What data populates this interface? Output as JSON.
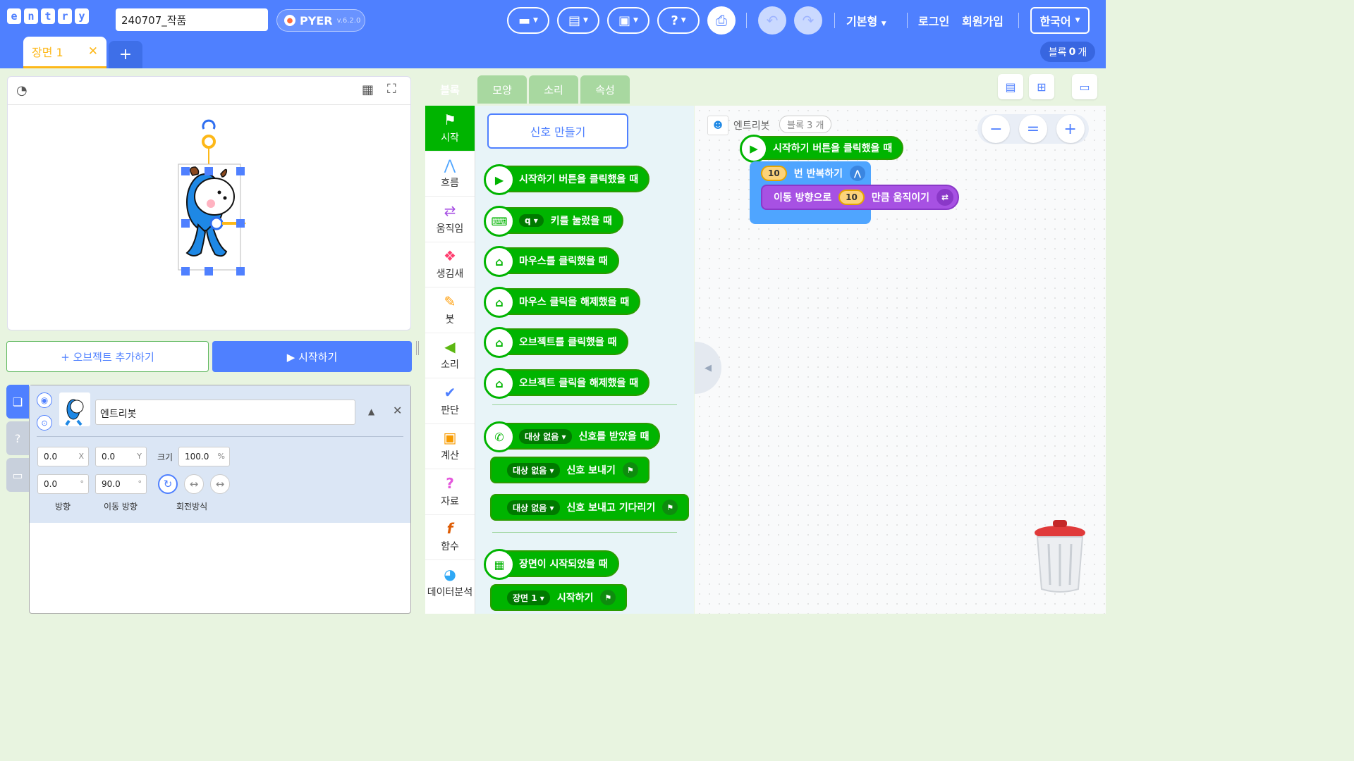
{
  "app": {
    "logo_letters": [
      "e",
      "n",
      "t",
      "r",
      "y"
    ],
    "project_title": "240707_작품",
    "pyer_label": "PYER",
    "pyer_version": "v.6.2.0",
    "mode_label": "기본형",
    "login": "로그인",
    "signup": "회원가입",
    "language": "한국어"
  },
  "scene": {
    "tab_label": "장면 1",
    "close_glyph": "✕",
    "add_glyph": "+",
    "block_count_label": "블록",
    "block_count_value": "0",
    "block_count_unit": "개"
  },
  "stage": {
    "add_object": "+ 오브젝트 추가하기",
    "start": "▶ 시작하기"
  },
  "object": {
    "name": "엔트리봇",
    "x": "0.0",
    "x_unit": "X",
    "y": "0.0",
    "y_unit": "Y",
    "size_label": "크기",
    "size": "100.0",
    "size_unit": "%",
    "direction": "0.0",
    "move_direction": "90.0",
    "degree_unit": "°",
    "direction_label": "방향",
    "move_direction_label": "이동 방향",
    "rotation_label": "회전방식"
  },
  "block_tabs": [
    "블록",
    "모양",
    "소리",
    "속성"
  ],
  "categories": [
    {
      "label": "시작",
      "icon": "flag-icon"
    },
    {
      "label": "흐름",
      "icon": "flow-icon"
    },
    {
      "label": "움직임",
      "icon": "move-icon"
    },
    {
      "label": "생김새",
      "icon": "looks-icon"
    },
    {
      "label": "붓",
      "icon": "brush-icon"
    },
    {
      "label": "소리",
      "icon": "speaker-icon"
    },
    {
      "label": "판단",
      "icon": "check-icon"
    },
    {
      "label": "계산",
      "icon": "calc-icon"
    },
    {
      "label": "자료",
      "icon": "question-icon"
    },
    {
      "label": "함수",
      "icon": "function-icon"
    },
    {
      "label": "데이터분석",
      "icon": "pie-icon"
    }
  ],
  "palette": {
    "make_signal": "신호 만들기",
    "blocks": {
      "on_start": "시작하기 버튼을 클릭했을 때",
      "key_dd": "q",
      "key_pressed": "키를 눌렀을 때",
      "mouse_click": "마우스를 클릭했을 때",
      "mouse_release": "마우스 클릭을 해제했을 때",
      "obj_click": "오브젝트를 클릭했을 때",
      "obj_release": "오브젝트 클릭을 해제했을 때",
      "signal_dd": "대상 없음",
      "signal_received": "신호를 받았을 때",
      "send_signal": "신호 보내기",
      "send_signal_wait": "신호 보내고 기다리기",
      "scene_started": "장면이 시작되었을 때",
      "scene_dd": "장면 1",
      "start_scene": "시작하기"
    }
  },
  "workspace": {
    "object_name": "엔트리봇",
    "block_count": "블록 3 개",
    "on_start": "시작하기 버튼을 클릭했을 때",
    "repeat_count": "10",
    "repeat_label": "번 반복하기",
    "move_prefix": "이동 방향으로",
    "move_value": "10",
    "move_suffix": "만큼 움직이기"
  },
  "colors": {
    "topbar": "#4f80ff",
    "start_green": "#00b400",
    "flow_blue": "#4fa5ff",
    "move_purple": "#a751e3",
    "scene_tab_accent": "#fdb819"
  }
}
